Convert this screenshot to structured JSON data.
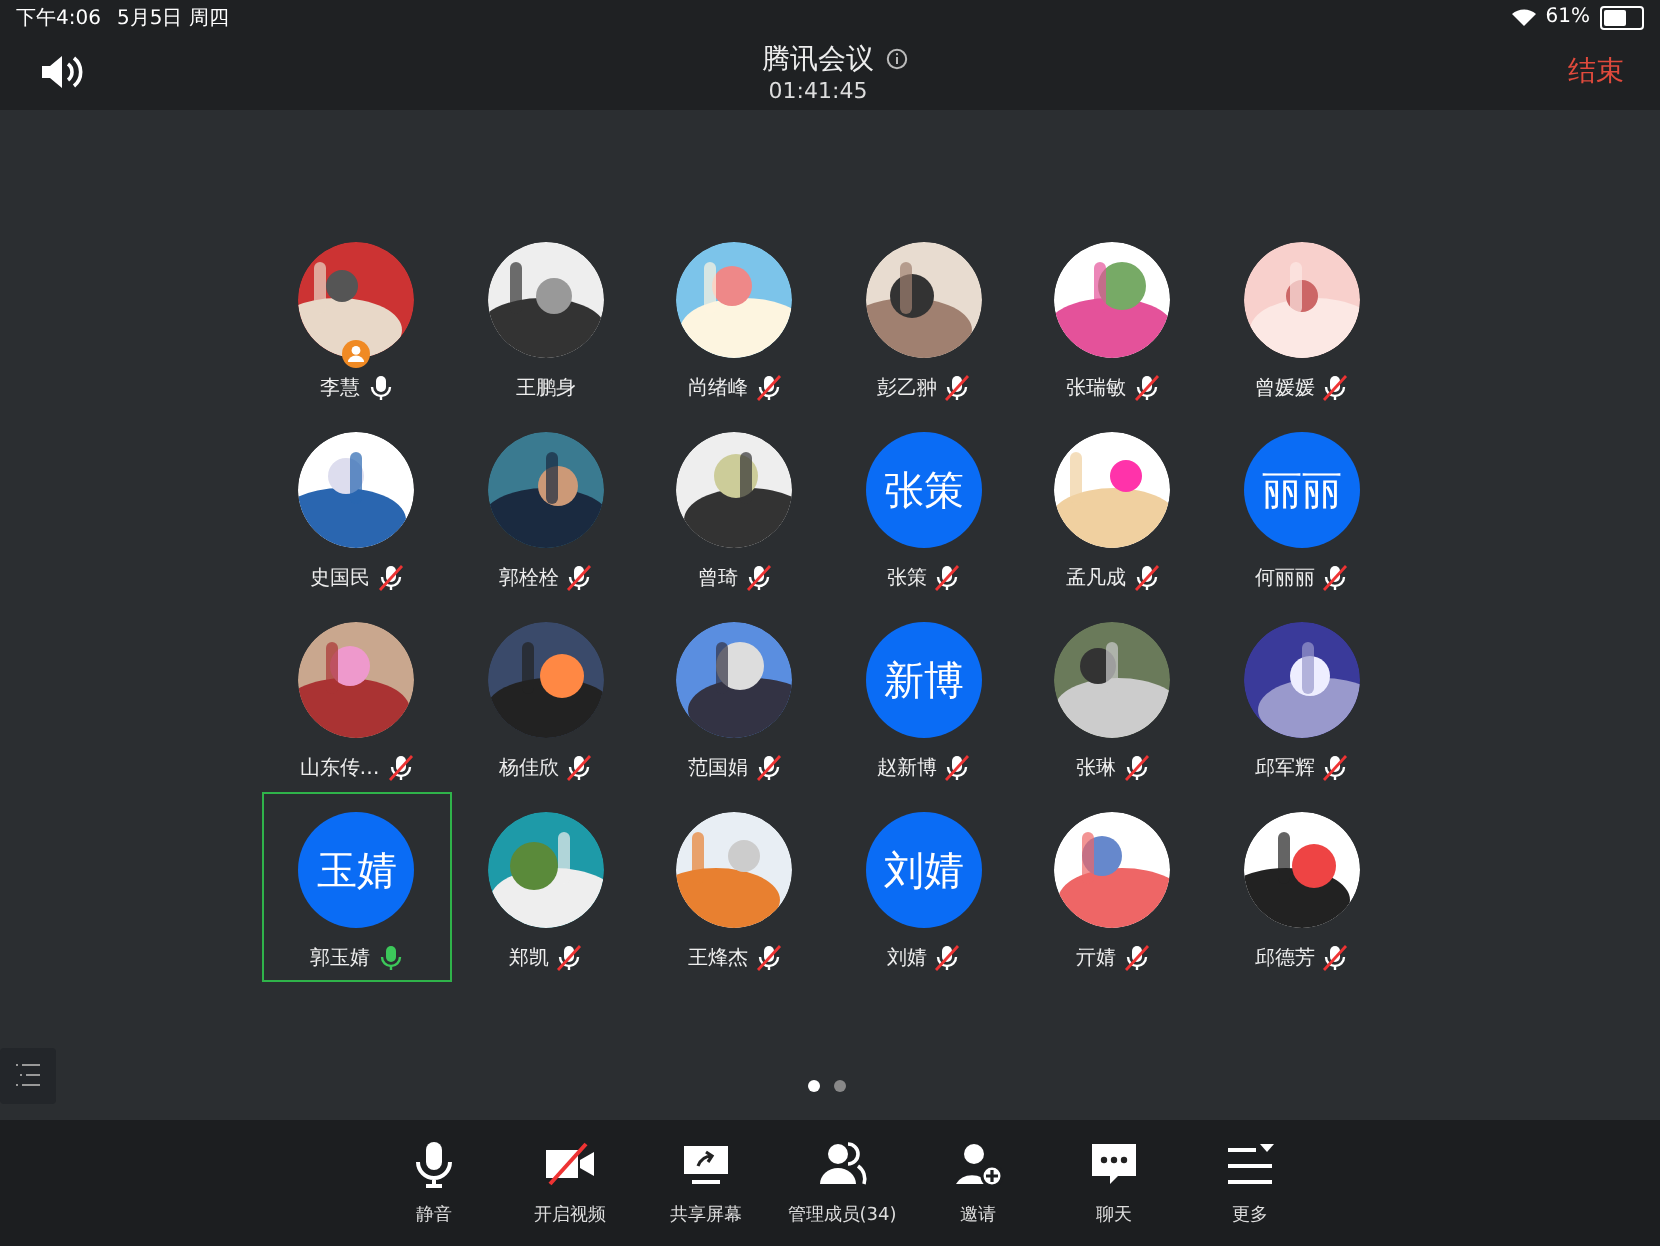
{
  "status_bar": {
    "time": "下午4:06",
    "date": "5月5日 周四",
    "battery": "61%"
  },
  "header": {
    "title": "腾讯会议",
    "duration": "01:41:45",
    "end_button": "结束"
  },
  "participants": [
    {
      "name": "李慧",
      "mic": {
        "muted": false,
        "speaking": false
      },
      "host": true,
      "selected": false
    },
    {
      "name": "王鹏身",
      "host": false,
      "selected": false
    },
    {
      "name": "尚绪峰",
      "mic": {
        "muted": true,
        "speaking": false
      },
      "host": false,
      "selected": false
    },
    {
      "name": "彭乙翀",
      "mic": {
        "muted": true,
        "speaking": false
      },
      "host": false,
      "selected": false
    },
    {
      "name": "张瑞敏",
      "mic": {
        "muted": true,
        "speaking": false
      },
      "host": false,
      "selected": false
    },
    {
      "name": "曾媛媛",
      "mic": {
        "muted": true,
        "speaking": false
      },
      "host": false,
      "selected": false
    },
    {
      "name": "史国民",
      "mic": {
        "muted": true,
        "speaking": false
      },
      "host": false,
      "selected": false
    },
    {
      "name": "郭栓栓",
      "mic": {
        "muted": true,
        "speaking": false
      },
      "host": false,
      "selected": false
    },
    {
      "name": "曾琦",
      "mic": {
        "muted": true,
        "speaking": false
      },
      "host": false,
      "selected": false
    },
    {
      "name": "张策",
      "avatar": {
        "kind": "initials",
        "text": "张策"
      },
      "mic": {
        "muted": true,
        "speaking": false
      },
      "host": false,
      "selected": false
    },
    {
      "name": "孟凡成",
      "mic": {
        "muted": true,
        "speaking": false
      },
      "host": false,
      "selected": false
    },
    {
      "name": "何丽丽",
      "avatar": {
        "kind": "initials",
        "text": "丽丽"
      },
      "mic": {
        "muted": true,
        "speaking": false
      },
      "host": false,
      "selected": false
    },
    {
      "name": "山东传…",
      "mic": {
        "muted": true,
        "speaking": false
      },
      "host": false,
      "selected": false
    },
    {
      "name": "杨佳欣",
      "mic": {
        "muted": true,
        "speaking": false
      },
      "host": false,
      "selected": false
    },
    {
      "name": "范国娟",
      "mic": {
        "muted": true,
        "speaking": false
      },
      "host": false,
      "selected": false
    },
    {
      "name": "赵新博",
      "avatar": {
        "kind": "initials",
        "text": "新博"
      },
      "mic": {
        "muted": true,
        "speaking": false
      },
      "host": false,
      "selected": false
    },
    {
      "name": "张琳",
      "mic": {
        "muted": true,
        "speaking": false
      },
      "host": false,
      "selected": false
    },
    {
      "name": "邱军辉",
      "mic": {
        "muted": true,
        "speaking": false
      },
      "host": false,
      "selected": false
    },
    {
      "name": "郭玉婧",
      "avatar": {
        "kind": "initials",
        "text": "玉婧"
      },
      "mic": {
        "muted": false,
        "speaking": true
      },
      "host": false,
      "selected": true
    },
    {
      "name": "郑凯",
      "mic": {
        "muted": true,
        "speaking": false
      },
      "host": false,
      "selected": false
    },
    {
      "name": "王烽杰",
      "mic": {
        "muted": true,
        "speaking": false
      },
      "host": false,
      "selected": false
    },
    {
      "name": "刘婧",
      "avatar": {
        "kind": "initials",
        "text": "刘婧"
      },
      "mic": {
        "muted": true,
        "speaking": false
      },
      "host": false,
      "selected": false
    },
    {
      "name": "亓婧",
      "mic": {
        "muted": true,
        "speaking": false
      },
      "host": false,
      "selected": false
    },
    {
      "name": "邱德芳",
      "mic": {
        "muted": true,
        "speaking": false
      },
      "host": false,
      "selected": false
    }
  ],
  "pages": [
    {
      "selected": true
    },
    {
      "selected": false
    }
  ],
  "toolbar": [
    {
      "kind": "mic",
      "label": "静音"
    },
    {
      "kind": "video",
      "label": "开启视频",
      "off": true
    },
    {
      "kind": "share",
      "label": "共享屏幕"
    },
    {
      "kind": "members",
      "label": "管理成员(34)"
    },
    {
      "kind": "invite",
      "label": "邀请"
    },
    {
      "kind": "chat",
      "label": "聊天"
    },
    {
      "kind": "more",
      "label": "更多"
    }
  ]
}
